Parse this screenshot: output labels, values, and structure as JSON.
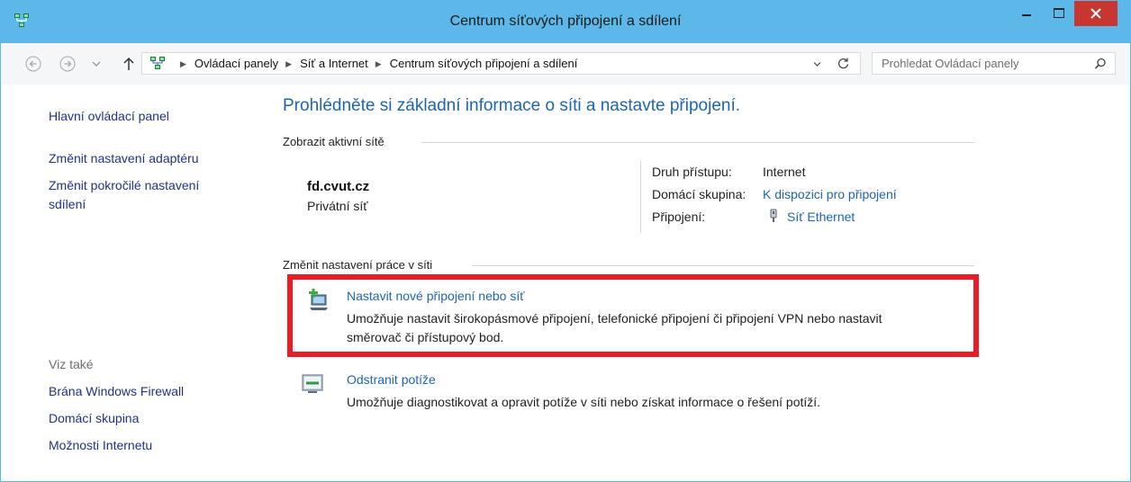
{
  "window": {
    "title": "Centrum síťových připojení a sdílení"
  },
  "navigation": {
    "breadcrumbs": [
      "Ovládací panely",
      "Síť a Internet",
      "Centrum síťových připojení a sdílení"
    ],
    "search_placeholder": "Prohledat Ovládací panely"
  },
  "sidebar": {
    "home_link": "Hlavní ovládací panel",
    "adapter_link": "Změnit nastavení adaptéru",
    "sharing_link_line1": "Změnit pokročilé nastavení",
    "sharing_link_line2": "sdílení",
    "see_also_heading": "Viz také",
    "see_also": [
      "Brána Windows Firewall",
      "Domácí skupina",
      "Možnosti Internetu"
    ]
  },
  "main": {
    "heading": "Prohlédněte si základní informace o síti a nastavte připojení.",
    "active_networks_label": "Zobrazit aktivní sítě",
    "network": {
      "name": "fd.cvut.cz",
      "type": "Privátní síť",
      "access_label": "Druh přístupu:",
      "access_value": "Internet",
      "homegroup_label": "Domácí skupina:",
      "homegroup_value": "K dispozici pro připojení",
      "connections_label": "Připojení:",
      "connections_value": "Síť Ethernet"
    },
    "change_settings_label": "Změnit nastavení práce v síti",
    "tasks": [
      {
        "title": "Nastavit nové připojení nebo síť",
        "desc_line1": "Umožňuje nastavit širokopásmové připojení, telefonické připojení či připojení VPN nebo nastavit",
        "desc_line2": "směrovač či přístupový bod.",
        "icon": "new-connection-icon"
      },
      {
        "title": "Odstranit potíže",
        "desc_line1": "Umožňuje diagnostikovat a opravit potíže v síti nebo získat informace o řešení potíží.",
        "icon": "troubleshoot-icon"
      }
    ]
  },
  "colors": {
    "titlebar": "#5cb8e8",
    "link": "#1e64b4",
    "sidebar_link": "#1e3287",
    "highlight": "#ec1c24",
    "close_button": "#c7372f"
  }
}
